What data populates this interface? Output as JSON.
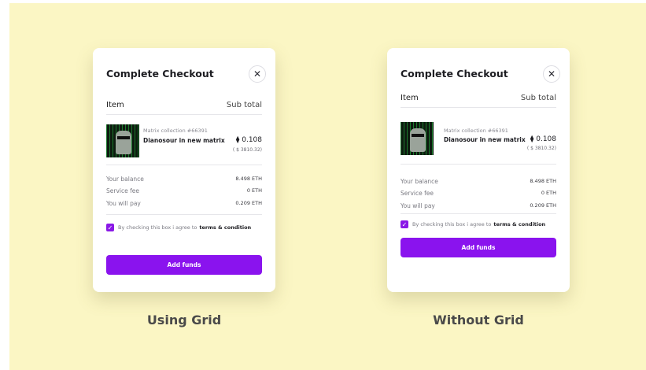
{
  "colors": {
    "background": "#fbf6c4",
    "accent": "#8a13ee"
  },
  "card_using_grid": {
    "title": "Complete Checkout",
    "close_icon": "close-icon",
    "item_header": "Item",
    "subtotal_header": "Sub total",
    "collection": "Matrix collection #66391",
    "name": "Dianosour in new matrix",
    "price": "⧫ 0.108",
    "price_usd": "( $ 3810.32)",
    "balance_label": "Your balance",
    "balance_value": "8.498 ETH",
    "fee_label": "Service fee",
    "fee_value": "0 ETH",
    "pay_label": "You will pay",
    "pay_value": "0.209 ETH",
    "agree_text": "By checking this box i agree to",
    "terms_link": "terms & condition",
    "button": "Add funds"
  },
  "card_without_grid": {
    "title": "Complete Checkout",
    "close_icon": "close-icon",
    "item_header": "Item",
    "subtotal_header": "Sub total",
    "collection": "Matrix collection #66391",
    "name": "Dianosour in new matrix",
    "price": "⧫ 0.108",
    "price_usd": "( $ 3810.32)",
    "balance_label": "Your balance",
    "balance_value": "8.498 ETH",
    "fee_label": "Service fee",
    "fee_value": "0 ETH",
    "pay_label": "You will pay",
    "pay_value": "0.209 ETH",
    "agree_text": "By checking this box i agree to",
    "terms_link": "terms & condition",
    "button": "Add funds"
  },
  "captions": {
    "left": "Using Grid",
    "right": "Without Grid"
  }
}
